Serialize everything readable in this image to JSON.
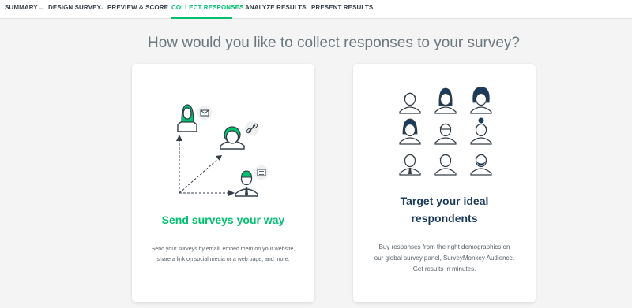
{
  "steps": [
    {
      "label": "SUMMARY",
      "active": false
    },
    {
      "label": "DESIGN SURVEY",
      "active": false
    },
    {
      "label": "PREVIEW & SCORE",
      "active": false
    },
    {
      "label": "COLLECT RESPONSES",
      "active": true
    },
    {
      "label": "ANALYZE RESULTS",
      "active": false
    },
    {
      "label": "PRESENT RESULTS",
      "active": false
    }
  ],
  "headline": "How would you like to collect responses to your survey?",
  "cards": {
    "send": {
      "title": "Send surveys your way",
      "desc_line1": "Send your surveys by email, embed them on your website,",
      "desc_line2": "share a link on social media or a web page, and more."
    },
    "target": {
      "title_line1": "Target your ideal",
      "title_line2": "respondents",
      "desc_line1": "Buy responses from the right demographics on",
      "desc_line2": "our global survey panel, SurveyMonkey Audience.",
      "desc_line3": "Get results in minutes."
    }
  },
  "colors": {
    "accent": "#00bf6f",
    "navy": "#1a3b5c",
    "background": "#f4f4f4"
  },
  "icons": {
    "mail": "mail-icon",
    "link": "link-icon",
    "form": "form-icon",
    "arrow": "arrow-right-icon"
  }
}
